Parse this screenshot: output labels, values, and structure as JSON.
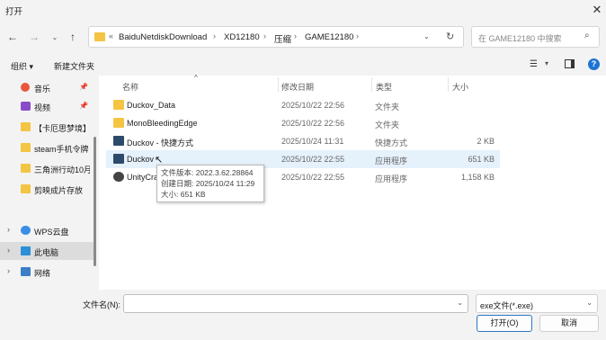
{
  "window": {
    "title": "打开"
  },
  "address": {
    "prefix": "«",
    "segments": [
      "BaiduNetdiskDownload",
      "XD12180",
      "压缩",
      "GAME12180"
    ],
    "sep": "›"
  },
  "search": {
    "placeholder": "在 GAME12180 中搜索"
  },
  "toolbar": {
    "organize": "组织 ▾",
    "new_folder": "新建文件夹"
  },
  "sidebar": {
    "items": [
      {
        "label": "音乐",
        "pinned": true
      },
      {
        "label": "视频",
        "pinned": true
      },
      {
        "label": "【卡厄思梦境】"
      },
      {
        "label": "steam手机令牌"
      },
      {
        "label": "三角洲行动10月"
      },
      {
        "label": "剪映成片存放"
      },
      {
        "label": "WPS云盘"
      },
      {
        "label": "此电脑"
      },
      {
        "label": "网络"
      }
    ]
  },
  "columns": {
    "name": "名称",
    "date": "修改日期",
    "type": "类型",
    "size": "大小"
  },
  "files": [
    {
      "name": "Duckov_Data",
      "date": "2025/10/22 22:56",
      "type": "文件夹",
      "size": ""
    },
    {
      "name": "MonoBleedingEdge",
      "date": "2025/10/22 22:56",
      "type": "文件夹",
      "size": ""
    },
    {
      "name": "Duckov - 快捷方式",
      "date": "2025/10/24 11:31",
      "type": "快捷方式",
      "size": "2 KB"
    },
    {
      "name": "Duckov",
      "date": "2025/10/22 22:55",
      "type": "应用程序",
      "size": "651 KB"
    },
    {
      "name": "UnityCra",
      "date": "2025/10/22 22:55",
      "type": "应用程序",
      "size": "1,158 KB"
    }
  ],
  "tooltip": {
    "version": "文件版本: 2022.3.62.28864",
    "created": "创建日期: 2025/10/24 11:29",
    "size": "大小: 651 KB"
  },
  "bottom": {
    "filename_label": "文件名(N):",
    "filename_value": "",
    "filetype": "exe文件(*.exe)",
    "open": "打开(O)",
    "cancel": "取消"
  },
  "colors": {
    "accent": "#2b78c5",
    "selected_row": "#e5f1fb",
    "folder": "#f4c443"
  }
}
